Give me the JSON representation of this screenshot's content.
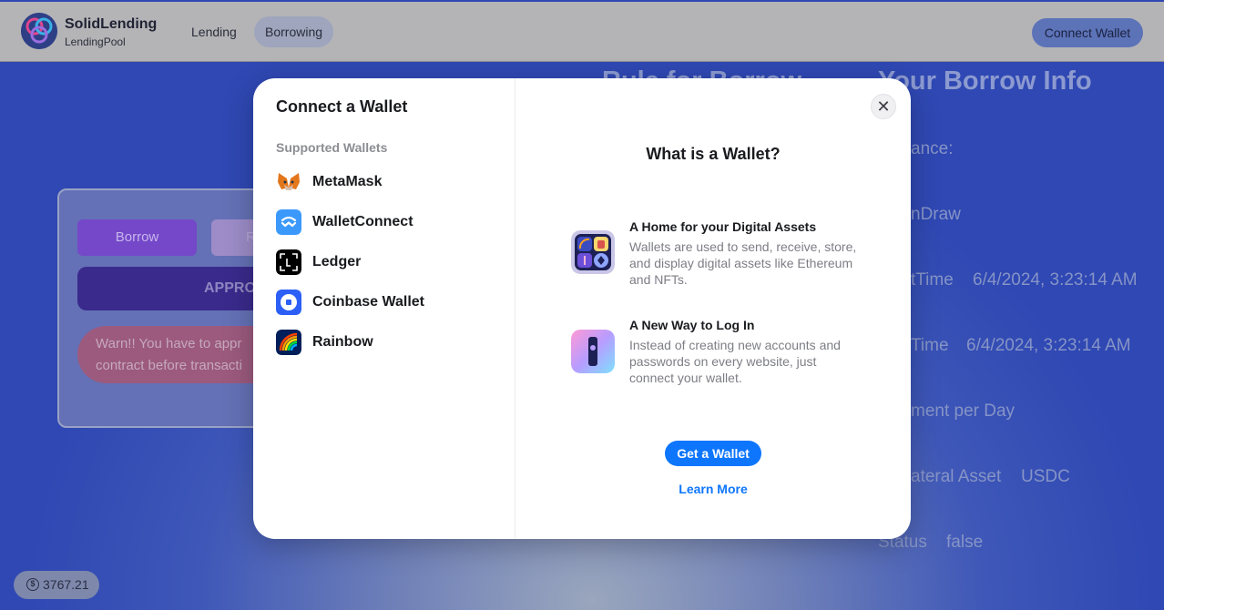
{
  "header": {
    "brand_name": "SolidLending",
    "brand_sub": "LendingPool",
    "nav": [
      {
        "label": "Lending"
      },
      {
        "label": "Borrowing"
      }
    ],
    "connect_label": "Connect Wallet"
  },
  "background": {
    "rule_title": "Rule for Borrow",
    "info_title": "Your Borrow Info",
    "info_rows": [
      {
        "label": "ance:",
        "value": ""
      },
      {
        "label": "nDraw",
        "value": ""
      },
      {
        "label": "tTime",
        "value": "6/4/2024, 3:23:14 AM"
      },
      {
        "label": "Time",
        "value": "6/4/2024, 3:23:14 AM"
      },
      {
        "label": "ment per Day",
        "value": ""
      },
      {
        "label": "ateral Asset",
        "value": "USDC"
      },
      {
        "label": "Status",
        "value": "false"
      }
    ],
    "card": {
      "tab_borrow": "Borrow",
      "tab_second": "R",
      "approve": "APPRO",
      "warn_line1": "Warn!! You have to appr",
      "warn_line2": "contract before transacti"
    },
    "balance": "3767.21",
    "balance_icon": "dollar-icon"
  },
  "modal": {
    "title": "Connect a Wallet",
    "section_label": "Supported Wallets",
    "wallets": [
      {
        "name": "MetaMask",
        "icon": "metamask-icon"
      },
      {
        "name": "WalletConnect",
        "icon": "walletconnect-icon"
      },
      {
        "name": "Ledger",
        "icon": "ledger-icon"
      },
      {
        "name": "Coinbase Wallet",
        "icon": "coinbase-icon"
      },
      {
        "name": "Rainbow",
        "icon": "rainbow-icon"
      }
    ],
    "close_icon": "close-icon",
    "right_title": "What is a Wallet?",
    "features": [
      {
        "title": "A Home for your Digital Assets",
        "desc": "Wallets are used to send, receive, store, and display digital assets like Ethereum and NFTs."
      },
      {
        "title": "A New Way to Log In",
        "desc": "Instead of creating new accounts and passwords on every website, just connect your wallet."
      }
    ],
    "get_wallet": "Get a Wallet",
    "learn_more": "Learn More"
  },
  "colors": {
    "accent": "#0e76fd",
    "page_bg": "#3e57b8",
    "header_bg": "#b4b4b7"
  }
}
